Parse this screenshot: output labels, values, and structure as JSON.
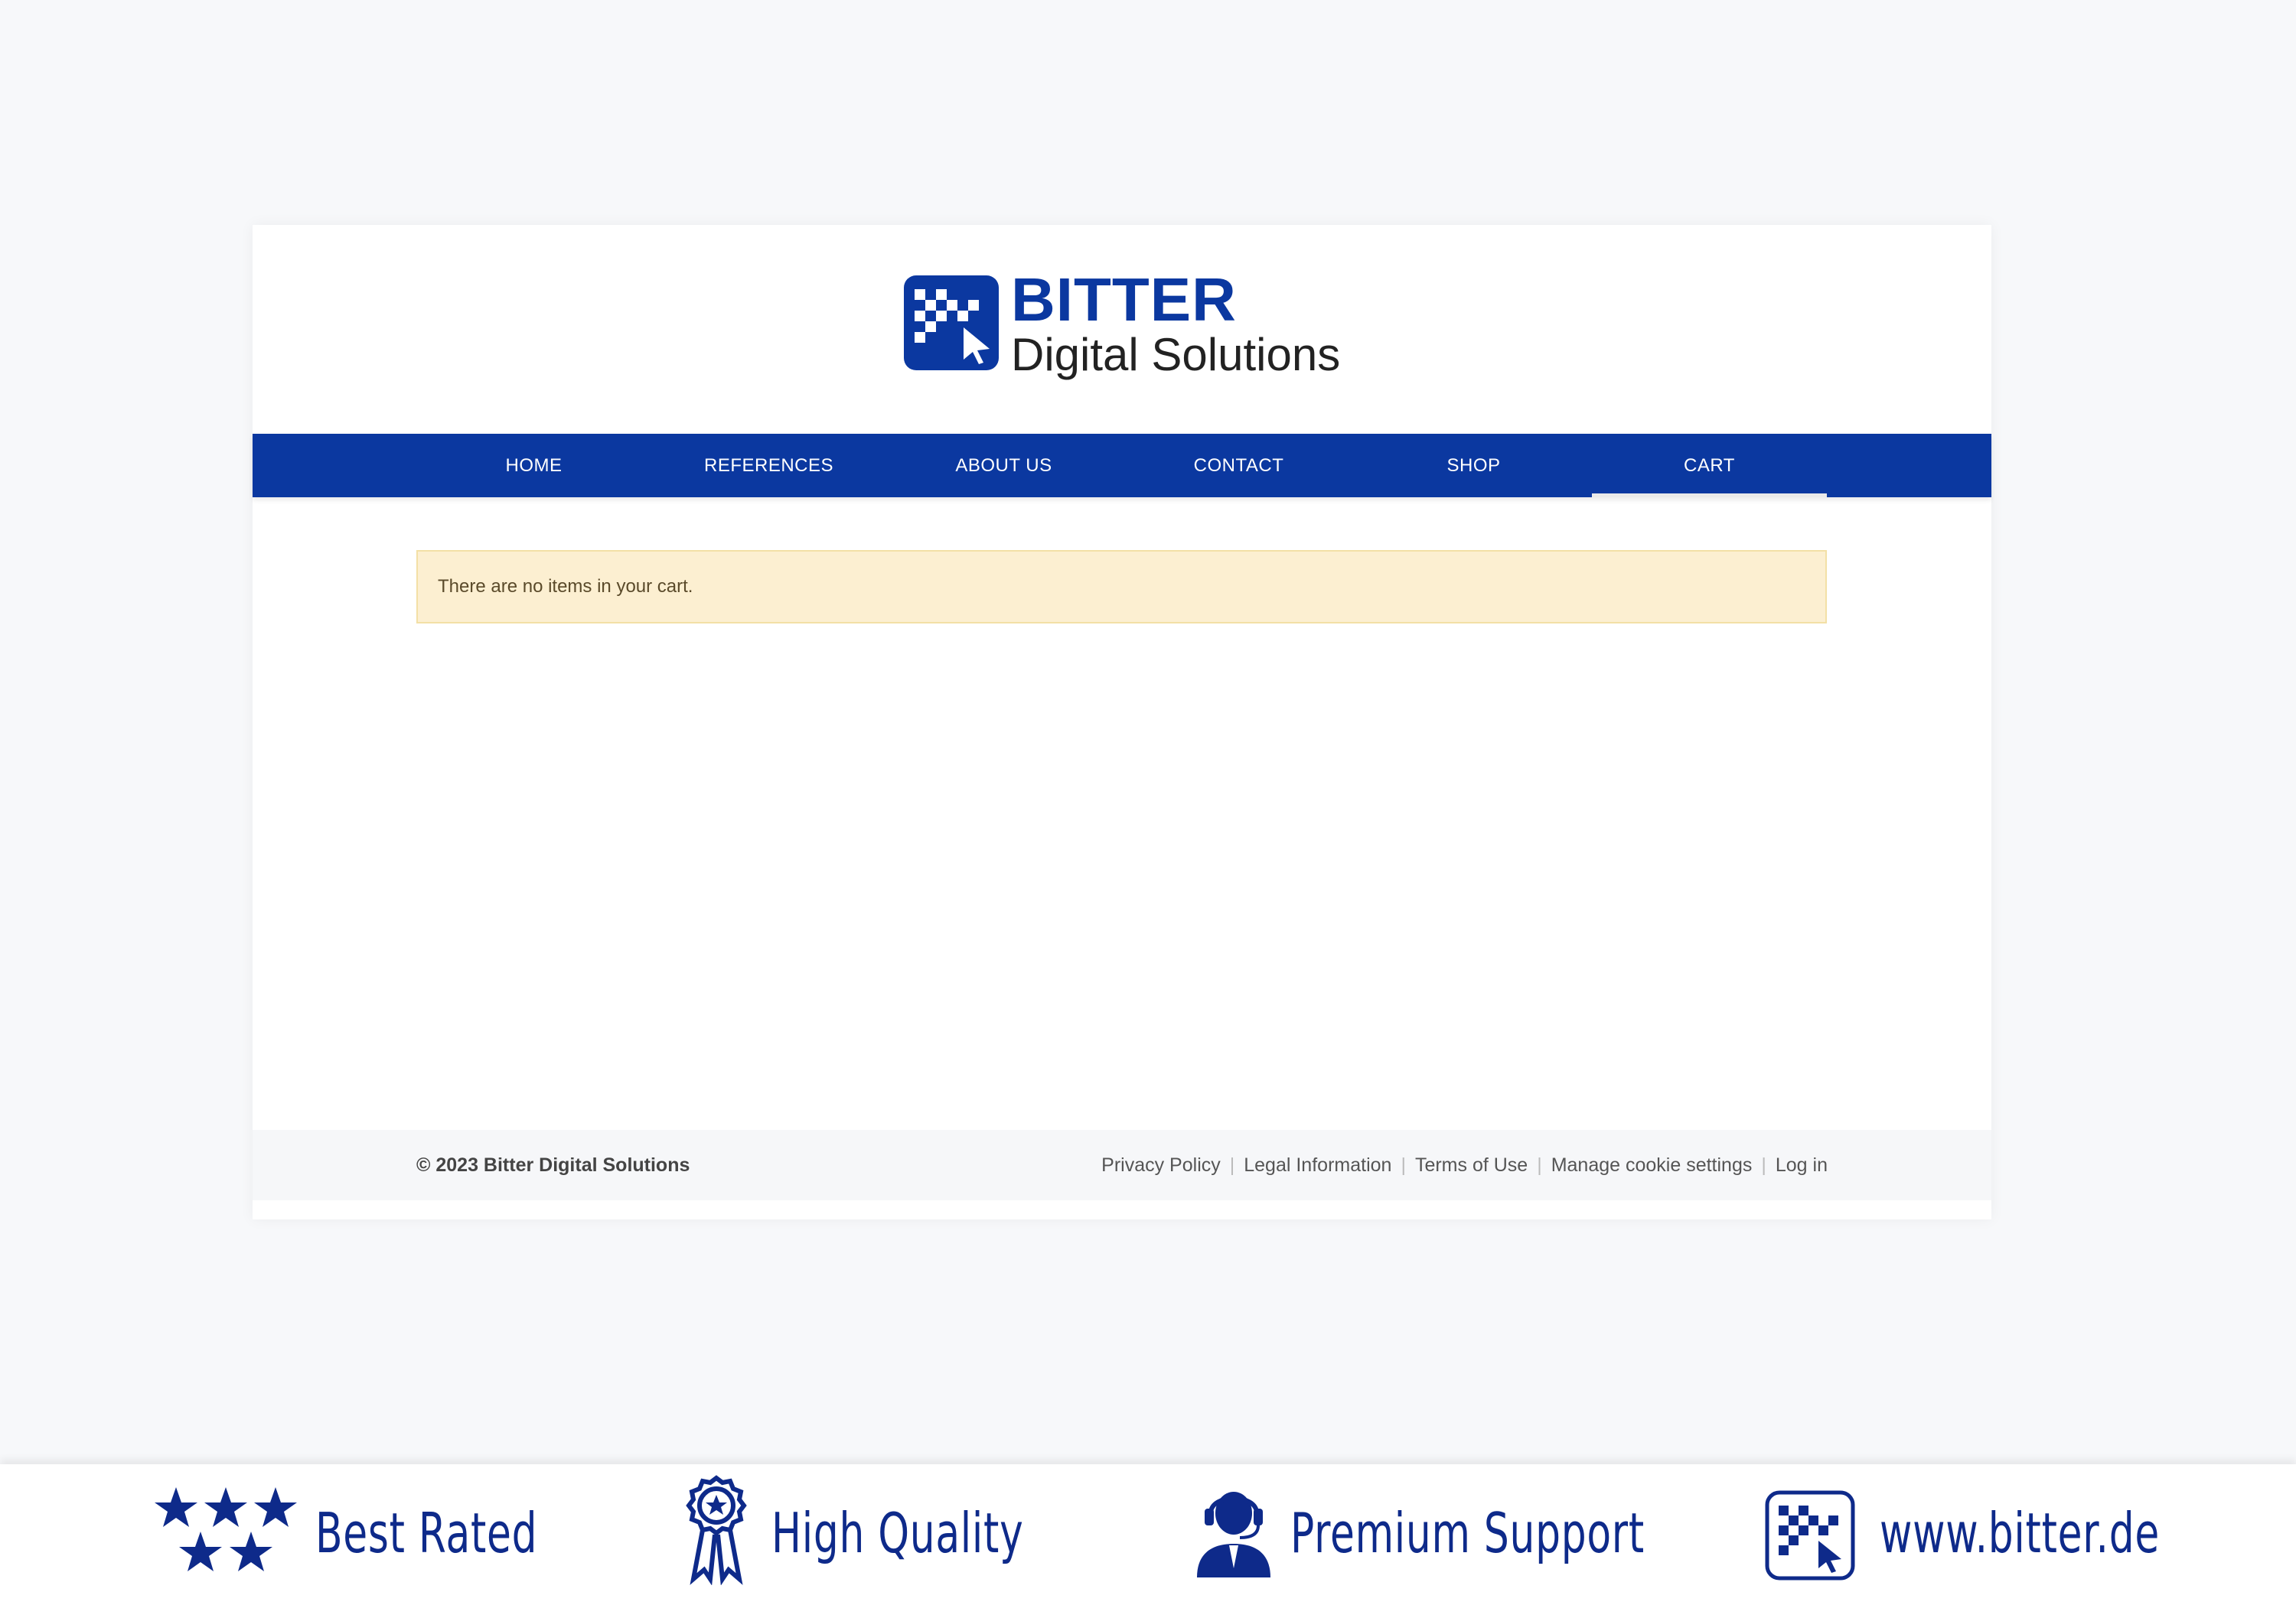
{
  "brand": {
    "title": "BITTER",
    "subtitle": "Digital Solutions",
    "color": "#0b38a0"
  },
  "nav": {
    "items": [
      {
        "label": "HOME"
      },
      {
        "label": "REFERENCES"
      },
      {
        "label": "ABOUT US"
      },
      {
        "label": "CONTACT"
      },
      {
        "label": "SHOP"
      },
      {
        "label": "CART"
      }
    ],
    "active": "CART"
  },
  "cart": {
    "empty_message": "There are no items in your cart."
  },
  "footer": {
    "copyright": "© 2023 Bitter Digital Solutions",
    "links": [
      {
        "label": "Privacy Policy"
      },
      {
        "label": "Legal Information"
      },
      {
        "label": "Terms of Use"
      },
      {
        "label": "Manage cookie settings"
      },
      {
        "label": "Log in"
      }
    ]
  },
  "banner": {
    "items": [
      {
        "label": "Best Rated",
        "icon": "stars-icon"
      },
      {
        "label": "High Quality",
        "icon": "award-ribbon-icon"
      },
      {
        "label": "Premium Support",
        "icon": "support-agent-icon"
      },
      {
        "label": "www.bitter.de",
        "icon": "bitter-logo-icon"
      }
    ]
  }
}
